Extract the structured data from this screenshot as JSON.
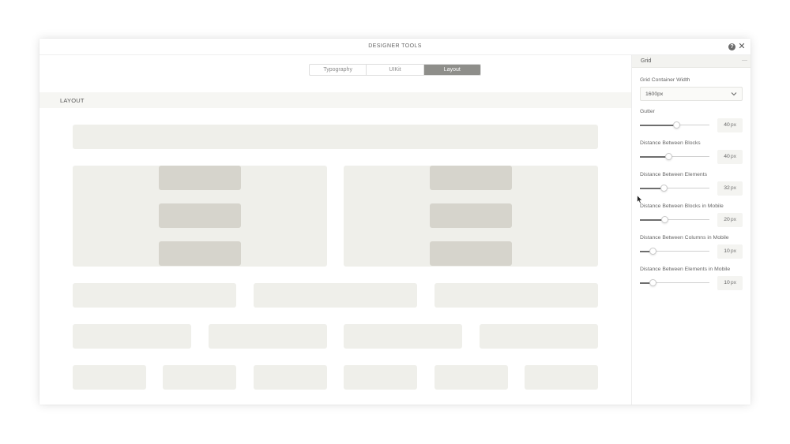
{
  "window": {
    "title": "DESIGNER TOOLS",
    "help_icon": "help-icon",
    "close_icon": "close-icon"
  },
  "tabs": [
    {
      "label": "Typography",
      "active": false
    },
    {
      "label": "UIKit",
      "active": false
    },
    {
      "label": "Layout",
      "active": true
    }
  ],
  "preview": {
    "section_label": "LAYOUT"
  },
  "panel": {
    "title": "Grid",
    "collapse_icon": "—",
    "grid_container_width": {
      "label": "Grid Container Width",
      "value": "1600px"
    },
    "sliders": [
      {
        "label": "Gutter",
        "value": "40",
        "unit": "px",
        "level": 0.53
      },
      {
        "label": "Distance Between Blocks",
        "value": "40",
        "unit": "px",
        "level": 0.42
      },
      {
        "label": "Distance Between Elements",
        "value": "32",
        "unit": "px",
        "level": 0.35
      },
      {
        "label": "Distance Between Blocks in Mobile",
        "value": "20",
        "unit": "px",
        "level": 0.36
      },
      {
        "label": "Distance Between Columns in Mobile",
        "value": "10",
        "unit": "px",
        "level": 0.19
      },
      {
        "label": "Distance Between Elements in Mobile",
        "value": "10",
        "unit": "px",
        "level": 0.19
      }
    ]
  },
  "colors": {
    "block": "#efefea",
    "inner_block": "#d6d4cc",
    "active_tab": "#8e8e8a"
  }
}
